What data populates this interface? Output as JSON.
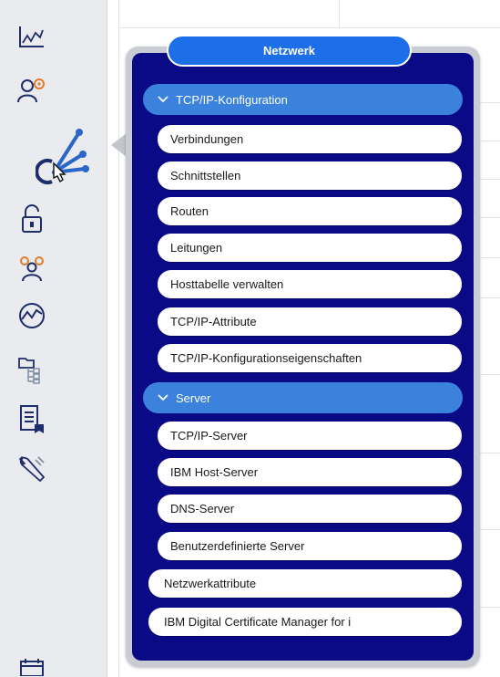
{
  "sidebar": {
    "icons": [
      {
        "name": "chart-line-icon"
      },
      {
        "name": "user-settings-icon"
      },
      {
        "name": "network-icon",
        "active": true
      },
      {
        "name": "lock-open-icon"
      },
      {
        "name": "users-group-icon"
      },
      {
        "name": "performance-gauge-icon"
      },
      {
        "name": "folder-tree-icon"
      },
      {
        "name": "document-list-icon"
      },
      {
        "name": "wrench-icon"
      },
      {
        "name": "calendar-icon"
      }
    ]
  },
  "popup": {
    "title": "Netzwerk",
    "groups": [
      {
        "label": "TCP/IP-Konfiguration",
        "items": [
          "Verbindungen",
          "Schnittstellen",
          "Routen",
          "Leitungen",
          "Hosttabelle verwalten",
          "TCP/IP-Attribute",
          "TCP/IP-Konfigurationseigenschaften"
        ]
      },
      {
        "label": "Server",
        "items": [
          "TCP/IP-Server",
          "IBM Host-Server",
          "DNS-Server",
          "Benutzerdefinierte Server"
        ]
      }
    ],
    "top_items": [
      "Netzwerkattribute",
      "IBM Digital Certificate Manager for i"
    ]
  },
  "colors": {
    "popup_bg": "#0a0a86",
    "title_bg": "#1d6ee9",
    "group_bg": "#3a82dc",
    "sidebar_bg": "#e9ebee",
    "icon_color": "#1f2d6b"
  }
}
